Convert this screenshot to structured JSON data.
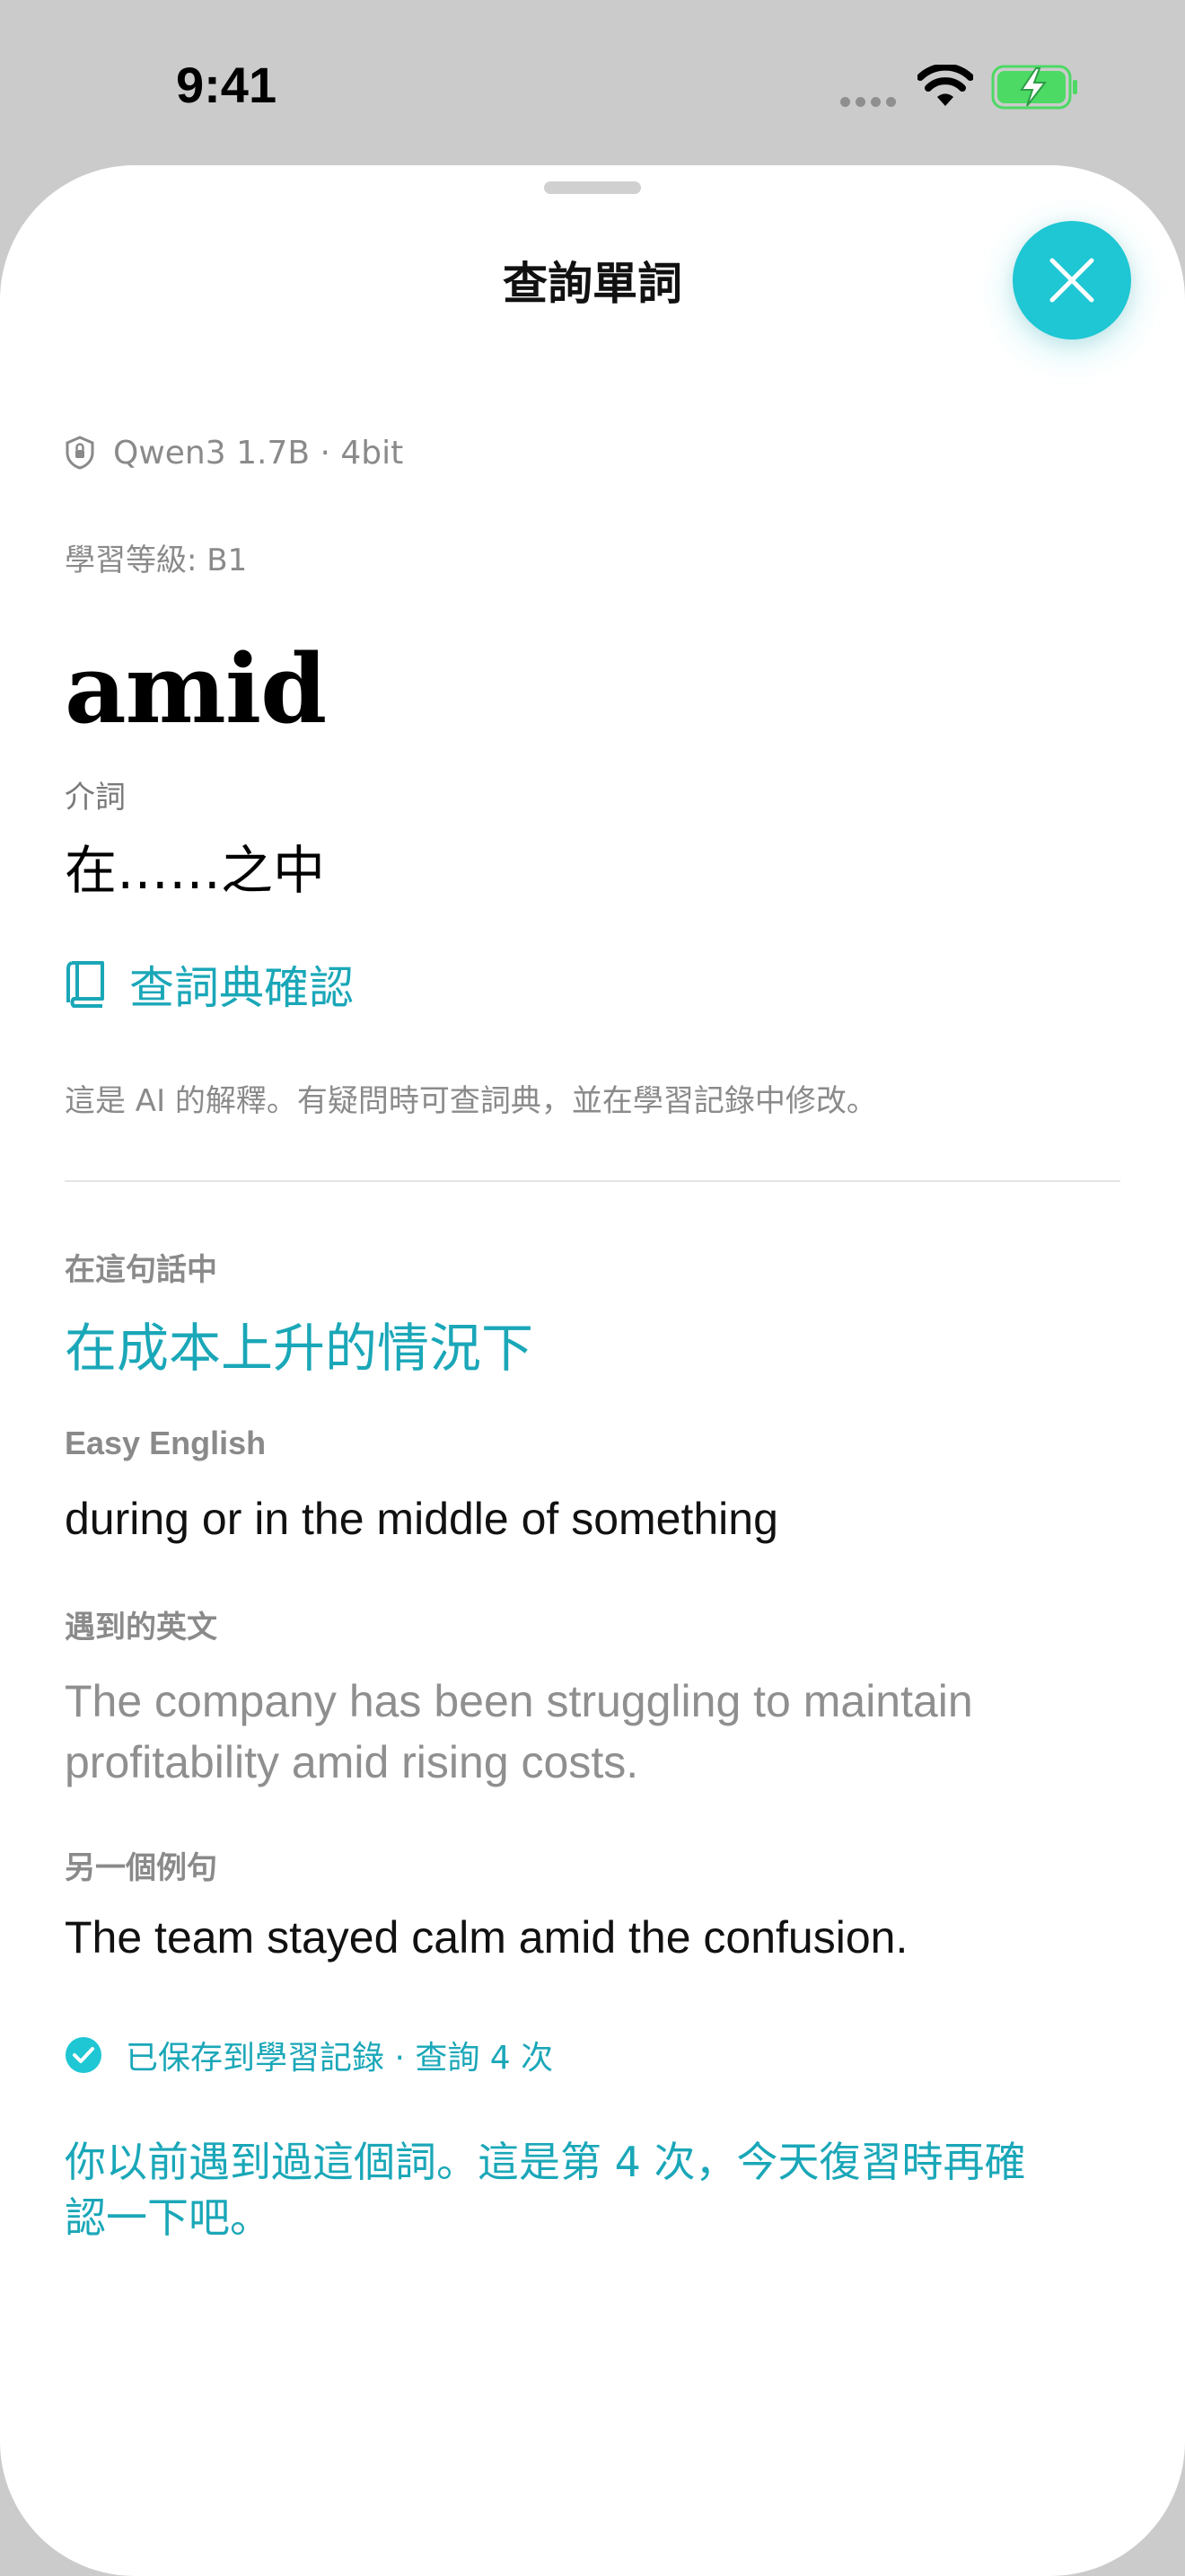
{
  "status_bar": {
    "time": "9:41"
  },
  "sheet": {
    "title": "查詢單詞"
  },
  "model": {
    "label": "Qwen3 1.7B · 4bit"
  },
  "word": {
    "level": "學習等級: B1",
    "headword": "amid",
    "part_of_speech": "介詞",
    "meaning": "在……之中"
  },
  "dictionary": {
    "label": "查詞典確認"
  },
  "ai_note": "這是 AI 的解釋。有疑問時可查詞典，並在學習記錄中修改。",
  "context": {
    "label": "在這句話中",
    "value": "在成本上升的情況下"
  },
  "easy_english": {
    "label": "Easy English",
    "value": "during or in the middle of something"
  },
  "encountered": {
    "label": "遇到的英文",
    "value": "The company has been struggling to maintain profitability amid rising costs."
  },
  "example": {
    "label": "另一個例句",
    "value": "The team stayed calm amid the confusion."
  },
  "saved": {
    "text": "已保存到學習記錄 · 查詢 4 次"
  },
  "review_note": "你以前遇到過這個詞。這是第 4 次，今天復習時再確認一下吧。",
  "colors": {
    "accent": "#1aa7b8",
    "close_button": "#1ec7d3",
    "battery": "#4cd964"
  },
  "icons": [
    "shield-icon",
    "book-icon",
    "check-circle-icon",
    "close-icon",
    "wifi-icon",
    "battery-charging-icon"
  ]
}
